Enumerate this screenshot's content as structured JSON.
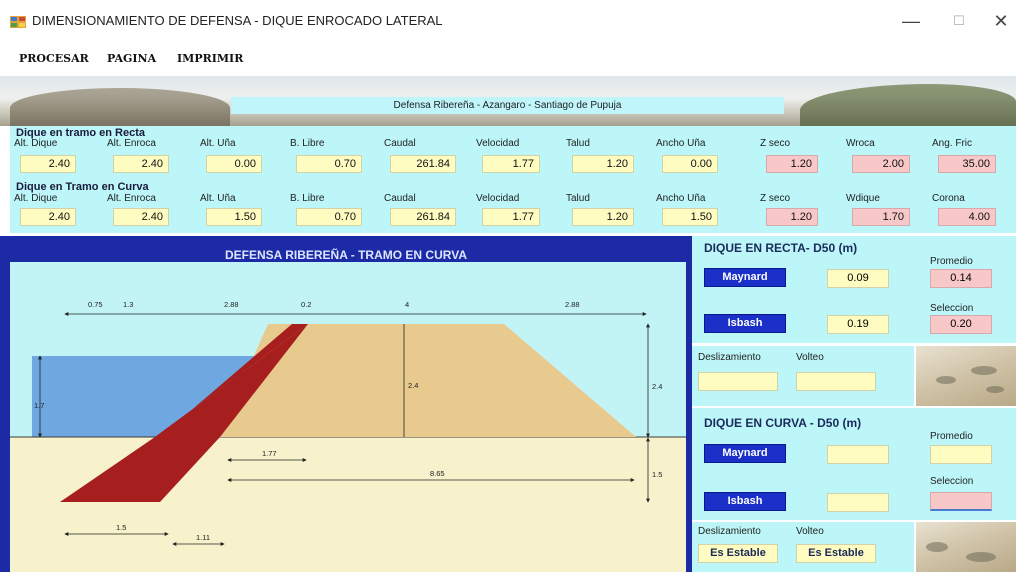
{
  "window": {
    "title": "DIMENSIONAMIENTO DE DEFENSA - DIQUE ENROCADO LATERAL",
    "minimize_glyph": "—",
    "maximize_glyph": "☐",
    "close_glyph": "✕",
    "icon": "app-grid-icon"
  },
  "menu": {
    "items": [
      "PROCESAR",
      "PAGINA",
      "IMPRIMIR"
    ]
  },
  "banner": {
    "label": "Defensa Ribereña - Azangaro - Santiago de Pupuja"
  },
  "recta": {
    "title": "Dique en tramo en Recta",
    "fields": [
      {
        "label": "Alt. Dique",
        "value": "2.40",
        "highlight": false
      },
      {
        "label": "Alt. Enroca",
        "value": "2.40",
        "highlight": false
      },
      {
        "label": "Alt. Uña",
        "value": "0.00",
        "highlight": false
      },
      {
        "label": "B. Libre",
        "value": "0.70",
        "highlight": false
      },
      {
        "label": "Caudal",
        "value": "261.84",
        "highlight": false
      },
      {
        "label": "Velocidad",
        "value": "1.77",
        "highlight": false
      },
      {
        "label": "Talud",
        "value": "1.20",
        "highlight": false
      },
      {
        "label": "Ancho Uña",
        "value": "0.00",
        "highlight": false
      },
      {
        "label": "Z seco",
        "value": "1.20",
        "highlight": true
      },
      {
        "label": "Wroca",
        "value": "2.00",
        "highlight": true
      },
      {
        "label": "Ang. Fric",
        "value": "35.00",
        "highlight": true
      }
    ]
  },
  "curva": {
    "title": "Dique en Tramo en Curva",
    "fields": [
      {
        "label": "Alt. Dique",
        "value": "2.40",
        "highlight": false
      },
      {
        "label": "Alt. Enroca",
        "value": "2.40",
        "highlight": false
      },
      {
        "label": "Alt. Uña",
        "value": "1.50",
        "highlight": false
      },
      {
        "label": "B. Libre",
        "value": "0.70",
        "highlight": false
      },
      {
        "label": "Caudal",
        "value": "261.84",
        "highlight": false
      },
      {
        "label": "Velocidad",
        "value": "1.77",
        "highlight": false
      },
      {
        "label": "Talud",
        "value": "1.20",
        "highlight": false
      },
      {
        "label": "Ancho Uña",
        "value": "1.50",
        "highlight": false
      },
      {
        "label": "Z seco",
        "value": "1.20",
        "highlight": true
      },
      {
        "label": "Wdique",
        "value": "1.70",
        "highlight": true
      },
      {
        "label": "Corona",
        "value": "4.00",
        "highlight": true
      }
    ]
  },
  "diagram": {
    "title": "DEFENSA RIBEREÑA - TRAMO EN CURVA",
    "dims_top": [
      "0.75",
      "1.3",
      "2.88",
      "0.2",
      "4",
      "2.88"
    ],
    "water_height": "1.7",
    "core_height": "2.4",
    "right_height_top": "2.4",
    "right_height_bottom": "1.5",
    "dim_velocity": "1.77",
    "dim_total": "8.65",
    "dim_bottom_left": "1.5",
    "dim_bottom_right": "1.11",
    "colors": {
      "sky": "#c2f4f6",
      "water": "#6fa8e0",
      "ground": "#f7f1cc",
      "core": "#e8c98e",
      "riprap": "#a61e1e"
    }
  },
  "side": {
    "recta_heading": "DIQUE EN RECTA- D50 (m)",
    "curva_heading": "DIQUE EN CURVA - D50 (m)",
    "promedio_label": "Promedio",
    "seleccion_label": "Seleccion",
    "maynard_label": "Maynard",
    "isbash_label": "Isbash",
    "recta_maynard": "0.09",
    "recta_isbash": "0.19",
    "recta_promedio": "0.14",
    "recta_seleccion": "0.20",
    "curva_maynard": "",
    "curva_isbash": "",
    "curva_promedio": "",
    "curva_seleccion": "",
    "deslizamiento_label": "Deslizamiento",
    "volteo_label": "Volteo",
    "recta_deslizamiento": "",
    "recta_volteo": "",
    "curva_deslizamiento": "Es Estable",
    "curva_volteo": "Es Estable"
  }
}
